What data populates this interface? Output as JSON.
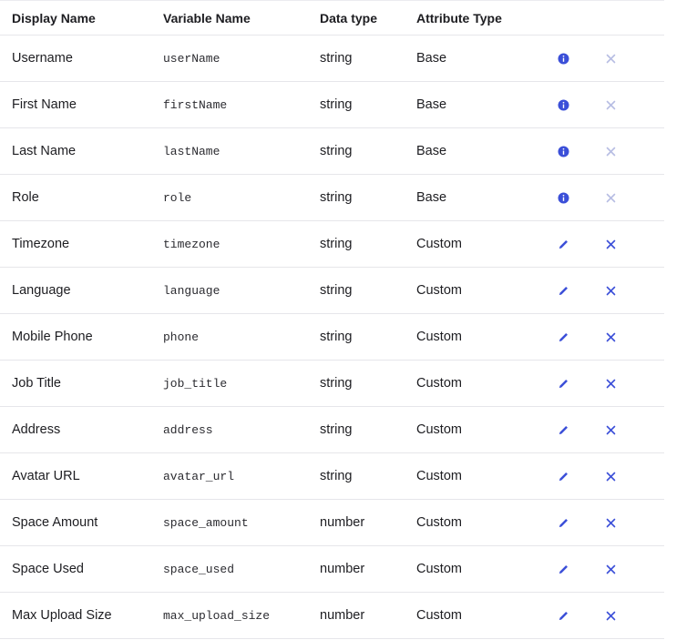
{
  "colors": {
    "accent": "#3b4fd8",
    "disabled_icon": "#b7bde3",
    "divider": "#e6e6ea"
  },
  "table": {
    "headers": {
      "display_name": "Display Name",
      "variable_name": "Variable Name",
      "data_type": "Data type",
      "attribute_type": "Attribute Type"
    },
    "rows": [
      {
        "display_name": "Username",
        "variable_name": "userName",
        "data_type": "string",
        "attribute_type": "Base",
        "action_icon": "info-icon",
        "delete_enabled": false
      },
      {
        "display_name": "First Name",
        "variable_name": "firstName",
        "data_type": "string",
        "attribute_type": "Base",
        "action_icon": "info-icon",
        "delete_enabled": false
      },
      {
        "display_name": "Last Name",
        "variable_name": "lastName",
        "data_type": "string",
        "attribute_type": "Base",
        "action_icon": "info-icon",
        "delete_enabled": false
      },
      {
        "display_name": "Role",
        "variable_name": "role",
        "data_type": "string",
        "attribute_type": "Base",
        "action_icon": "info-icon",
        "delete_enabled": false
      },
      {
        "display_name": "Timezone",
        "variable_name": "timezone",
        "data_type": "string",
        "attribute_type": "Custom",
        "action_icon": "pencil-icon",
        "delete_enabled": true
      },
      {
        "display_name": "Language",
        "variable_name": "language",
        "data_type": "string",
        "attribute_type": "Custom",
        "action_icon": "pencil-icon",
        "delete_enabled": true
      },
      {
        "display_name": "Mobile Phone",
        "variable_name": "phone",
        "data_type": "string",
        "attribute_type": "Custom",
        "action_icon": "pencil-icon",
        "delete_enabled": true
      },
      {
        "display_name": "Job Title",
        "variable_name": "job_title",
        "data_type": "string",
        "attribute_type": "Custom",
        "action_icon": "pencil-icon",
        "delete_enabled": true
      },
      {
        "display_name": "Address",
        "variable_name": "address",
        "data_type": "string",
        "attribute_type": "Custom",
        "action_icon": "pencil-icon",
        "delete_enabled": true
      },
      {
        "display_name": "Avatar URL",
        "variable_name": "avatar_url",
        "data_type": "string",
        "attribute_type": "Custom",
        "action_icon": "pencil-icon",
        "delete_enabled": true
      },
      {
        "display_name": "Space Amount",
        "variable_name": "space_amount",
        "data_type": "number",
        "attribute_type": "Custom",
        "action_icon": "pencil-icon",
        "delete_enabled": true
      },
      {
        "display_name": "Space Used",
        "variable_name": "space_used",
        "data_type": "number",
        "attribute_type": "Custom",
        "action_icon": "pencil-icon",
        "delete_enabled": true
      },
      {
        "display_name": "Max Upload Size",
        "variable_name": "max_upload_size",
        "data_type": "number",
        "attribute_type": "Custom",
        "action_icon": "pencil-icon",
        "delete_enabled": true
      }
    ]
  }
}
